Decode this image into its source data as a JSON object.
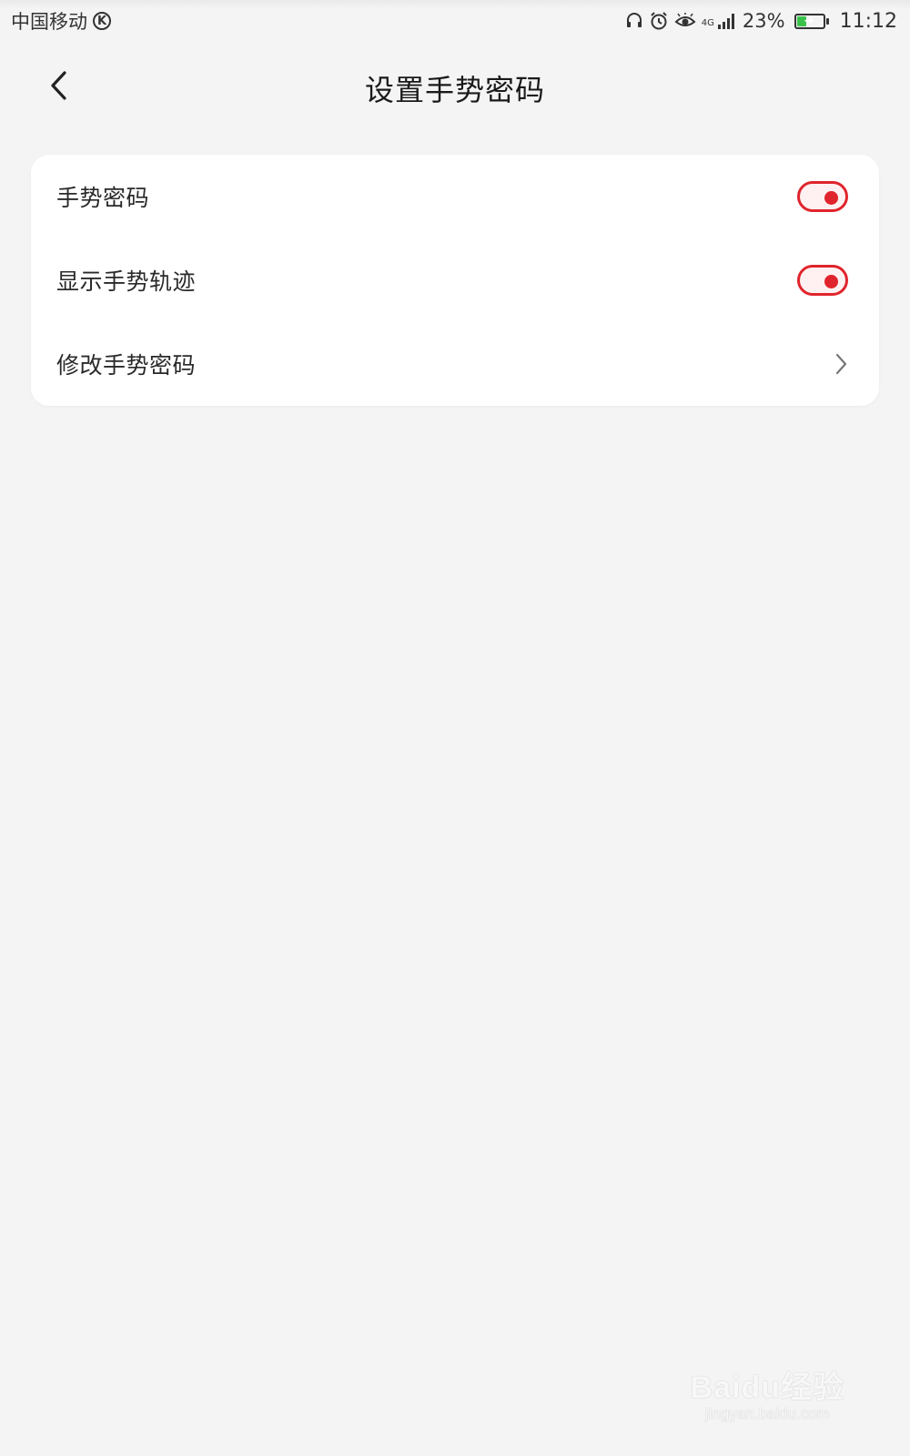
{
  "status_bar": {
    "carrier": "中国移动",
    "carrier_badge": "K",
    "network_tag": "4G",
    "battery_level": 0.23,
    "battery_text": "23%",
    "time": "11:12",
    "icons": [
      "headset-icon",
      "alarm-icon",
      "eye-comfort-icon",
      "signal-icon",
      "battery-icon"
    ]
  },
  "header": {
    "title": "设置手势密码",
    "back_icon": "chevron-left-icon"
  },
  "settings": {
    "items": [
      {
        "label": "手势密码",
        "type": "toggle",
        "on": true
      },
      {
        "label": "显示手势轨迹",
        "type": "toggle",
        "on": true
      },
      {
        "label": "修改手势密码",
        "type": "link",
        "icon": "chevron-right-icon"
      }
    ]
  },
  "watermark": {
    "logo": "Baidu经验",
    "url": "jingyan.baidu.com"
  },
  "colors": {
    "accent": "#e0242c",
    "background": "#f4f4f4",
    "card": "#ffffff",
    "battery_fill": "#3bc24a"
  }
}
